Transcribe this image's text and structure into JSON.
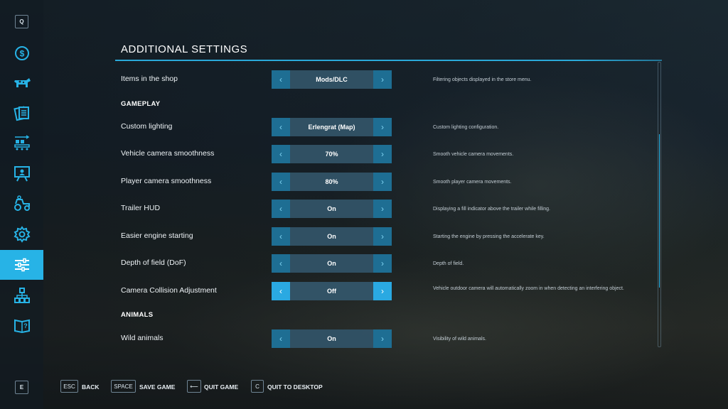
{
  "sidebar": {
    "top_key": "Q",
    "bottom_key": "E",
    "items": [
      {
        "icon": "dollar-icon"
      },
      {
        "icon": "cow-icon"
      },
      {
        "icon": "contracts-icon"
      },
      {
        "icon": "production-icon"
      },
      {
        "icon": "tutorial-icon"
      },
      {
        "icon": "vehicles-icon"
      },
      {
        "icon": "gear-icon"
      },
      {
        "icon": "sliders-icon",
        "active": true
      },
      {
        "icon": "network-icon"
      },
      {
        "icon": "help-book-icon"
      }
    ]
  },
  "page": {
    "title": "ADDITIONAL SETTINGS"
  },
  "settings": {
    "shop": {
      "label": "Items in the shop",
      "value": "Mods/DLC",
      "description": "Filtering objects displayed in the store menu."
    },
    "gameplay_header": "GAMEPLAY",
    "lighting": {
      "label": "Custom lighting",
      "value": "Erlengrat (Map)",
      "description": "Custom lighting configuration."
    },
    "vehicle_cam": {
      "label": "Vehicle camera smoothness",
      "value": "70%",
      "description": "Smooth vehicle camera movements."
    },
    "player_cam": {
      "label": "Player camera smoothness",
      "value": "80%",
      "description": "Smooth player camera movements."
    },
    "trailer_hud": {
      "label": "Trailer HUD",
      "value": "On",
      "description": "Displaying a fill indicator above the trailer while filling."
    },
    "engine_start": {
      "label": "Easier engine starting",
      "value": "On",
      "description": "Starting the engine by pressing the accelerate key."
    },
    "dof": {
      "label": "Depth of field (DoF)",
      "value": "On",
      "description": "Depth of field."
    },
    "collision": {
      "label": "Camera Collision Adjustment",
      "value": "Off",
      "description": "Vehicle outdoor camera will automatically zoom in when detecting an interfering object."
    },
    "animals_header": "ANIMALS",
    "wild_animals": {
      "label": "Wild animals",
      "value": "On",
      "description": "Visibility of wild animals."
    }
  },
  "scroll_position": 0.55,
  "footer": [
    {
      "key": "ESC",
      "label": "BACK"
    },
    {
      "key": "SPACE",
      "label": "SAVE GAME"
    },
    {
      "key": "⟵",
      "label": "QUIT GAME"
    },
    {
      "key": "C",
      "label": "QUIT TO DESKTOP"
    }
  ],
  "colors": {
    "accent": "#27b3e6",
    "arrow": "#1e6e93"
  }
}
